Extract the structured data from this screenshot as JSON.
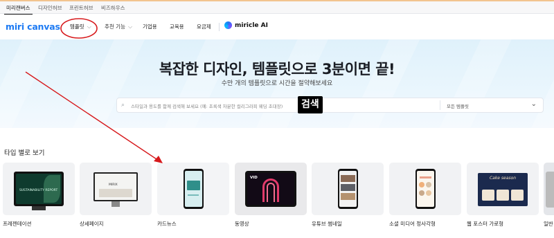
{
  "top_tabs": [
    "미리캔버스",
    "디자인허브",
    "프린트허브",
    "비즈하우스"
  ],
  "header": {
    "logo_text": "miri canvas",
    "nav": [
      "템플릿",
      "추천 기능",
      "기업용",
      "교육용",
      "요금제"
    ],
    "miricle_ai": "miricle AI"
  },
  "hero": {
    "title": "복잡한 디자인, 템플릿으로 3분이면 끝!",
    "subtitle": "수만 개의 템플릿으로 시간을 절약해보세요",
    "search_placeholder": "스타일과 용도를 함께 검색해 보세요 (예: 초록색 차분한 컬리그라피 웨딩 초대장)",
    "search_scope": "모든 템플릿",
    "annotation_label": "검색"
  },
  "section": {
    "title": "타입 별로 보기",
    "cards": [
      {
        "label": "프레젠테이션",
        "thumb_text": "SUSTAINABILITY REPORT"
      },
      {
        "label": "상세페이지",
        "thumb_text": "MIRIX"
      },
      {
        "label": "카드뉴스"
      },
      {
        "label": "동영상",
        "thumb_text": "VID"
      },
      {
        "label": "유튜브 썸네일"
      },
      {
        "label": "소셜 미디어 정사각형"
      },
      {
        "label": "웹 포스터 가로형",
        "thumb_text": "Cake season"
      },
      {
        "label": "일반"
      }
    ]
  },
  "annotation": {
    "color": "#d7191c",
    "circle_target": "템플릿"
  },
  "colors": {
    "brand": "#1d7af3",
    "annotation_red": "#d7191c",
    "hero_bg": "#e3f3fc"
  }
}
